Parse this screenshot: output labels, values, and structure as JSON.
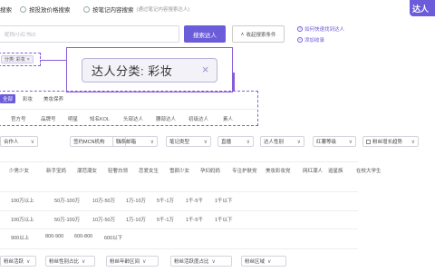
{
  "top": {
    "radio_search": "搜索",
    "radio_price": "按投放价格搜索",
    "radio_notes": "按笔记内容搜索",
    "hint": "(通过笔记内容搜索达人)",
    "cta": "达人 "
  },
  "search": {
    "placeholder": "昵称/小红书ID",
    "button": "搜索达人",
    "collapse": "收起搜索条件",
    "help": "如何快速找到达人",
    "favorite": "添加收录"
  },
  "small_tag": {
    "label": "分类: 彩妆",
    "close": "×"
  },
  "zoom_tag": {
    "label": "达人分类: 彩妆",
    "close": "×"
  },
  "categories": [
    "全部",
    "彩妆",
    "美妆保养"
  ],
  "types": [
    "官方号",
    "品牌号",
    "明星",
    "知名KOL",
    "头部达人",
    "腰部达人",
    "初级达人",
    "素人"
  ],
  "dropdowns": [
    "合作人",
    "签约MCN机构",
    "联系邮箱",
    "笔记类型",
    "直播",
    "达人性别",
    "红薯等级",
    "粉丝增长趋势"
  ],
  "tags_row": [
    "少男少女",
    "新手宝妈",
    "潮范潮女",
    "轻奢白领",
    "恋爱女生",
    "雪颜少女",
    "孕妇妈妈",
    "专注护肤党",
    "美妆彩妆党",
    "网红潮人",
    "追星族",
    "在校大学生"
  ],
  "fans_row": [
    "100万以上",
    "50万-100万",
    "10万-50万",
    "1万-10万",
    "5千-1万",
    "1千-5千",
    "1千以下"
  ],
  "price_row": [
    "100万以上",
    "50万-100万",
    "10万-50万",
    "1万-10万",
    "5千-1万",
    "1千-5千",
    "1千以下"
  ],
  "rate_row": [
    "900以上",
    "800-900",
    "600-800",
    "600以下"
  ],
  "bottom_dropdowns": [
    "粉丝活跃",
    "粉丝性别占比",
    "粉丝年龄区间",
    "粉丝活跃度占比",
    "粉丝区域"
  ],
  "colors": {
    "accent": "#6b5cd9",
    "highlight": "#8a5ad6"
  }
}
